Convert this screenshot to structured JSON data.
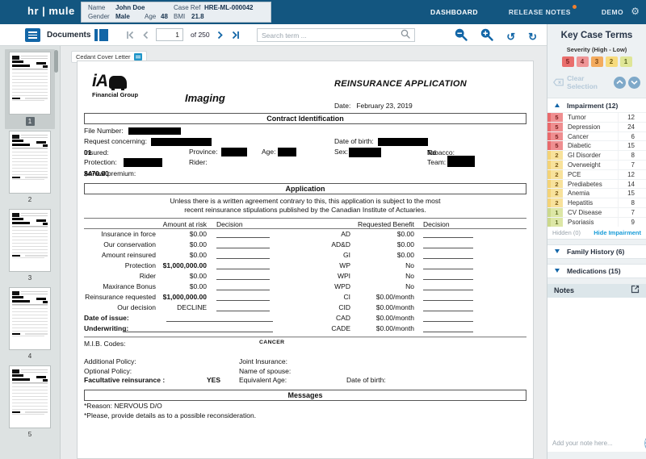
{
  "header": {
    "logo": "hr | mule",
    "patient": {
      "name_label": "Name",
      "name_value": "John Doe",
      "gender_label": "Gender",
      "gender_value": "Male",
      "age_label": "Age",
      "age_value": "48",
      "case_ref_label": "Case Ref",
      "case_ref_value": "HRE-ML-000042",
      "bmi_label": "BMI",
      "bmi_value": "21.8"
    },
    "nav": {
      "dashboard": "DASHBOARD",
      "release_notes": "RELEASE NOTES",
      "demo": "DEMO"
    }
  },
  "toolbar": {
    "documents_label": "Documents",
    "page_current": "1",
    "page_total": "of 250",
    "search_placeholder": "Search term ..."
  },
  "thumbnails": {
    "labels": [
      "1",
      "2",
      "3",
      "4",
      "5"
    ],
    "selected": "1"
  },
  "document": {
    "tag_label": "Cedant Cover Letter",
    "logo_text": "iA",
    "logo_subtext": "Financial Group",
    "imaging_label": "Imaging",
    "title": "REINSURANCE APPLICATION",
    "date_label": "Date:",
    "date_value": "February 23, 2019",
    "contract": {
      "section_title": "Contract Identification",
      "file_number_label": "File Number:",
      "request_label": "Request concerning:",
      "dob_label": "Date of birth:",
      "insured_label": "Insured:",
      "insured_value": "01",
      "province_label": "Province:",
      "age_label": "Age:",
      "sex_label": "Sex:",
      "tobacco_label": "Tobacco:",
      "tobacco_value": "No",
      "protection_label": "Protection:",
      "rider_label": "Rider:",
      "team_label": "Team:",
      "premium_label": "Annual premium:",
      "premium_value": "$470.00"
    },
    "application": {
      "section_title": "Application",
      "disclaimer_line1": "Unless there is a written agreement contrary to this, this application is subject to the most",
      "disclaimer_line2": "recent reinsurance stipulations published by the Canadian Institute of Actuaries.",
      "col_amount": "Amount at risk",
      "col_decision1": "Decision",
      "col_benefit": "Requested Benefit",
      "col_decision2": "Decision",
      "rows": [
        {
          "label": "Insurance in force",
          "amount": "$0.00",
          "code": "AD",
          "benefit": "$0.00"
        },
        {
          "label": "Our conservation",
          "amount": "$0.00",
          "code": "AD&D",
          "benefit": "$0.00"
        },
        {
          "label": "Amount reinsured",
          "amount": "$0.00",
          "code": "GI",
          "benefit": "$0.00"
        },
        {
          "label": "Protection",
          "amount": "$1,000,000.00",
          "code": "WP",
          "benefit": "No"
        },
        {
          "label": "Rider",
          "amount": "$0.00",
          "code": "WPI",
          "benefit": "No"
        },
        {
          "label": "Maxirance Bonus",
          "amount": "$0.00",
          "code": "WPD",
          "benefit": "No"
        },
        {
          "label": "Reinsurance requested",
          "amount": "$1,000,000.00",
          "code": "CI",
          "benefit": "$0.00/month"
        },
        {
          "label": "Our decision",
          "amount": "DECLINE",
          "code": "CID",
          "benefit": "$0.00/month"
        },
        {
          "label": "Date of issue:",
          "amount": "",
          "code": "CAD",
          "benefit": "$0.00/month"
        },
        {
          "label": "Underwriting:",
          "amount": "",
          "code": "CADE",
          "benefit": "$0.00/month"
        }
      ]
    },
    "mib_label": "M.I.B. Codes:",
    "mib_value": "CANCER",
    "additional_policy_label": "Additional Policy:",
    "joint_insurance_label": "Joint Insurance:",
    "optional_policy_label": "Optional Policy:",
    "spouse_label": "Name of spouse:",
    "facultative_label": "Facultative reinsurance :",
    "facultative_value": "YES",
    "equivalent_age_label": "Equivalent Age:",
    "dob2_label": "Date of birth:",
    "messages": {
      "section_title": "Messages",
      "line1": "*Reason: NERVOUS D/O",
      "line2": "*Please, provide details as to a possible reconsideration."
    }
  },
  "sidebar": {
    "title": "Key Case Terms",
    "severity_label": "Severity (High - Low)",
    "severity_levels": [
      "5",
      "4",
      "3",
      "2",
      "1"
    ],
    "clear_selection_label": "Clear Selection",
    "impairment": {
      "header": "Impairment (12)",
      "items": [
        {
          "severity": "5",
          "name": "Tumor",
          "count": "12"
        },
        {
          "severity": "5",
          "name": "Depression",
          "count": "24"
        },
        {
          "severity": "5",
          "name": "Cancer",
          "count": "6"
        },
        {
          "severity": "5",
          "name": "Diabetic",
          "count": "15"
        },
        {
          "severity": "2",
          "name": "GI Disorder",
          "count": "8"
        },
        {
          "severity": "2",
          "name": "Overweight",
          "count": "7"
        },
        {
          "severity": "2",
          "name": "PCE",
          "count": "12"
        },
        {
          "severity": "2",
          "name": "Prediabetes",
          "count": "14"
        },
        {
          "severity": "2",
          "name": "Anemia",
          "count": "15"
        },
        {
          "severity": "2",
          "name": "Hepatitis",
          "count": "8"
        },
        {
          "severity": "1",
          "name": "CV Disease",
          "count": "7"
        },
        {
          "severity": "1",
          "name": "Psoriasis",
          "count": "9"
        }
      ],
      "hidden_label": "Hidden (0)",
      "hide_link": "Hide Impairment"
    },
    "family_history_header": "Family History (6)",
    "medications_header": "Medications (15)",
    "notes": {
      "header": "Notes",
      "input_placeholder": "Add your note here..."
    }
  },
  "colors": {
    "header_bg": "#135680",
    "accent_blue": "#1266a7",
    "link_blue": "#189cd8",
    "release_badge": "#f07f2e",
    "severity_5": "#e96e6c",
    "severity_4": "#ef9697",
    "severity_3": "#f3ab5e",
    "severity_2": "#f7db7d",
    "severity_1": "#dfe697"
  }
}
